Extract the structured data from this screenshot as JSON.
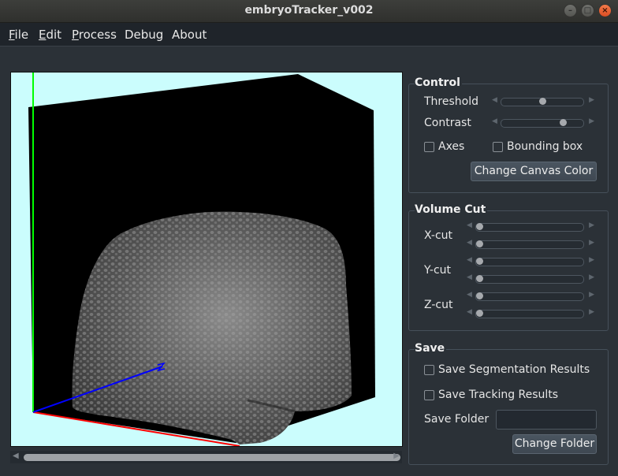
{
  "window": {
    "title": "embryoTracker_v002",
    "buttons": {
      "minimize": "–",
      "maximize": "□",
      "close": "×"
    }
  },
  "menu": [
    {
      "first": "F",
      "rest": "ile"
    },
    {
      "first": "E",
      "rest": "dit"
    },
    {
      "first": "P",
      "rest": "rocess"
    },
    {
      "first": "",
      "rest": "Debug"
    },
    {
      "first": "",
      "rest": "About"
    }
  ],
  "control": {
    "title": "Control",
    "threshold_label": "Threshold",
    "threshold_value": 0.5,
    "contrast_label": "Contrast",
    "contrast_value": 0.78,
    "axes_label": "Axes",
    "axes_checked": false,
    "bbox_label": "Bounding box",
    "bbox_checked": false,
    "canvas_color_button": "Change Canvas Color"
  },
  "volume_cut": {
    "title": "Volume Cut",
    "x_label": "X-cut",
    "y_label": "Y-cut",
    "z_label": "Z-cut"
  },
  "save": {
    "title": "Save",
    "seg_label": "Save Segmentation Results",
    "track_label": "Save Tracking Results",
    "folder_label": "Save Folder",
    "folder_value": "",
    "change_folder_button": "Change Folder"
  },
  "colors": {
    "canvas_bg": "#cbfdfd",
    "volume_bg": "#000000",
    "axis_x": "#ff0000",
    "axis_y": "#00ff00",
    "axis_z": "#0000ff"
  }
}
